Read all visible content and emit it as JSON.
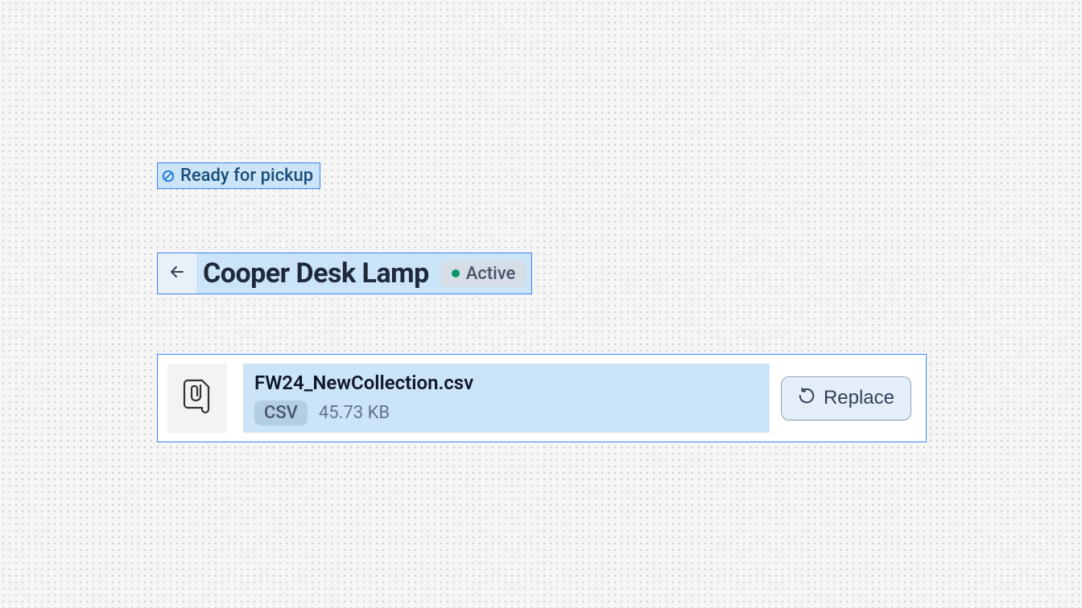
{
  "status_badge": {
    "label": "Ready for pickup"
  },
  "title_bar": {
    "title": "Cooper Desk Lamp",
    "status": "Active"
  },
  "file": {
    "name": "FW24_NewCollection.csv",
    "type": "CSV",
    "size": "45.73 KB",
    "replace_label": "Replace"
  }
}
